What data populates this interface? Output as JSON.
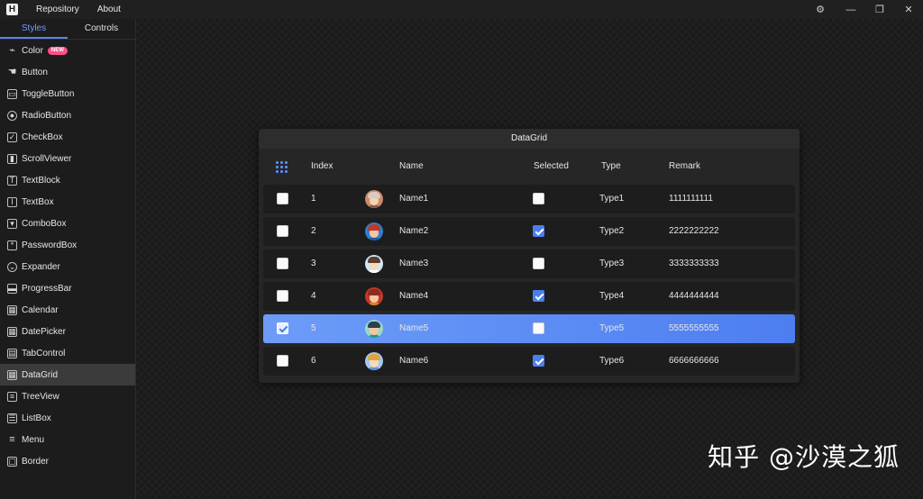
{
  "titlebar": {
    "logo": "H",
    "menu": [
      "Repository",
      "About"
    ],
    "controls": {
      "settings": "⚙",
      "minimize": "—",
      "restore": "❐",
      "close": "✕"
    }
  },
  "sidebar": {
    "tabs": [
      "Styles",
      "Controls"
    ],
    "active_tab": "Styles",
    "items": [
      {
        "label": "Color",
        "icon": "paint-brush-icon",
        "badge": "NEW"
      },
      {
        "label": "Button",
        "icon": "hand-pointer-icon"
      },
      {
        "label": "ToggleButton",
        "icon": "toggle-button-icon"
      },
      {
        "label": "RadioButton",
        "icon": "radio-button-icon"
      },
      {
        "label": "CheckBox",
        "icon": "checkbox-icon"
      },
      {
        "label": "ScrollViewer",
        "icon": "scroll-viewer-icon"
      },
      {
        "label": "TextBlock",
        "icon": "text-block-icon"
      },
      {
        "label": "TextBox",
        "icon": "text-box-icon"
      },
      {
        "label": "ComboBox",
        "icon": "combo-box-icon"
      },
      {
        "label": "PasswordBox",
        "icon": "password-box-icon"
      },
      {
        "label": "Expander",
        "icon": "expander-icon"
      },
      {
        "label": "ProgressBar",
        "icon": "progress-bar-icon"
      },
      {
        "label": "Calendar",
        "icon": "calendar-icon"
      },
      {
        "label": "DatePicker",
        "icon": "date-picker-icon"
      },
      {
        "label": "TabControl",
        "icon": "tab-control-icon"
      },
      {
        "label": "DataGrid",
        "icon": "data-grid-icon",
        "selected": true
      },
      {
        "label": "TreeView",
        "icon": "tree-view-icon"
      },
      {
        "label": "ListBox",
        "icon": "list-box-icon"
      },
      {
        "label": "Menu",
        "icon": "menu-icon"
      },
      {
        "label": "Border",
        "icon": "border-icon"
      }
    ]
  },
  "datagrid": {
    "title": "DataGrid",
    "columns": [
      "Index",
      "Name",
      "Selected",
      "Type",
      "Remark"
    ],
    "rows": [
      {
        "checked": false,
        "index": "1",
        "name": "Name1",
        "selected": false,
        "type": "Type1",
        "remark": "1111111111"
      },
      {
        "checked": false,
        "index": "2",
        "name": "Name2",
        "selected": true,
        "type": "Type2",
        "remark": "2222222222"
      },
      {
        "checked": false,
        "index": "3",
        "name": "Name3",
        "selected": false,
        "type": "Type3",
        "remark": "3333333333"
      },
      {
        "checked": false,
        "index": "4",
        "name": "Name4",
        "selected": true,
        "type": "Type4",
        "remark": "4444444444"
      },
      {
        "checked": true,
        "index": "5",
        "name": "Name5",
        "selected": false,
        "type": "Type5",
        "remark": "5555555555",
        "highlighted": true
      },
      {
        "checked": false,
        "index": "6",
        "name": "Name6",
        "selected": true,
        "type": "Type6",
        "remark": "6666666666"
      }
    ]
  },
  "watermark": "知乎 @沙漠之狐",
  "colors": {
    "accent": "#5b86f0",
    "selected_row_start": "#6d9cf8",
    "selected_row_end": "#4d7ef0",
    "badge": "#ff4f8b"
  }
}
